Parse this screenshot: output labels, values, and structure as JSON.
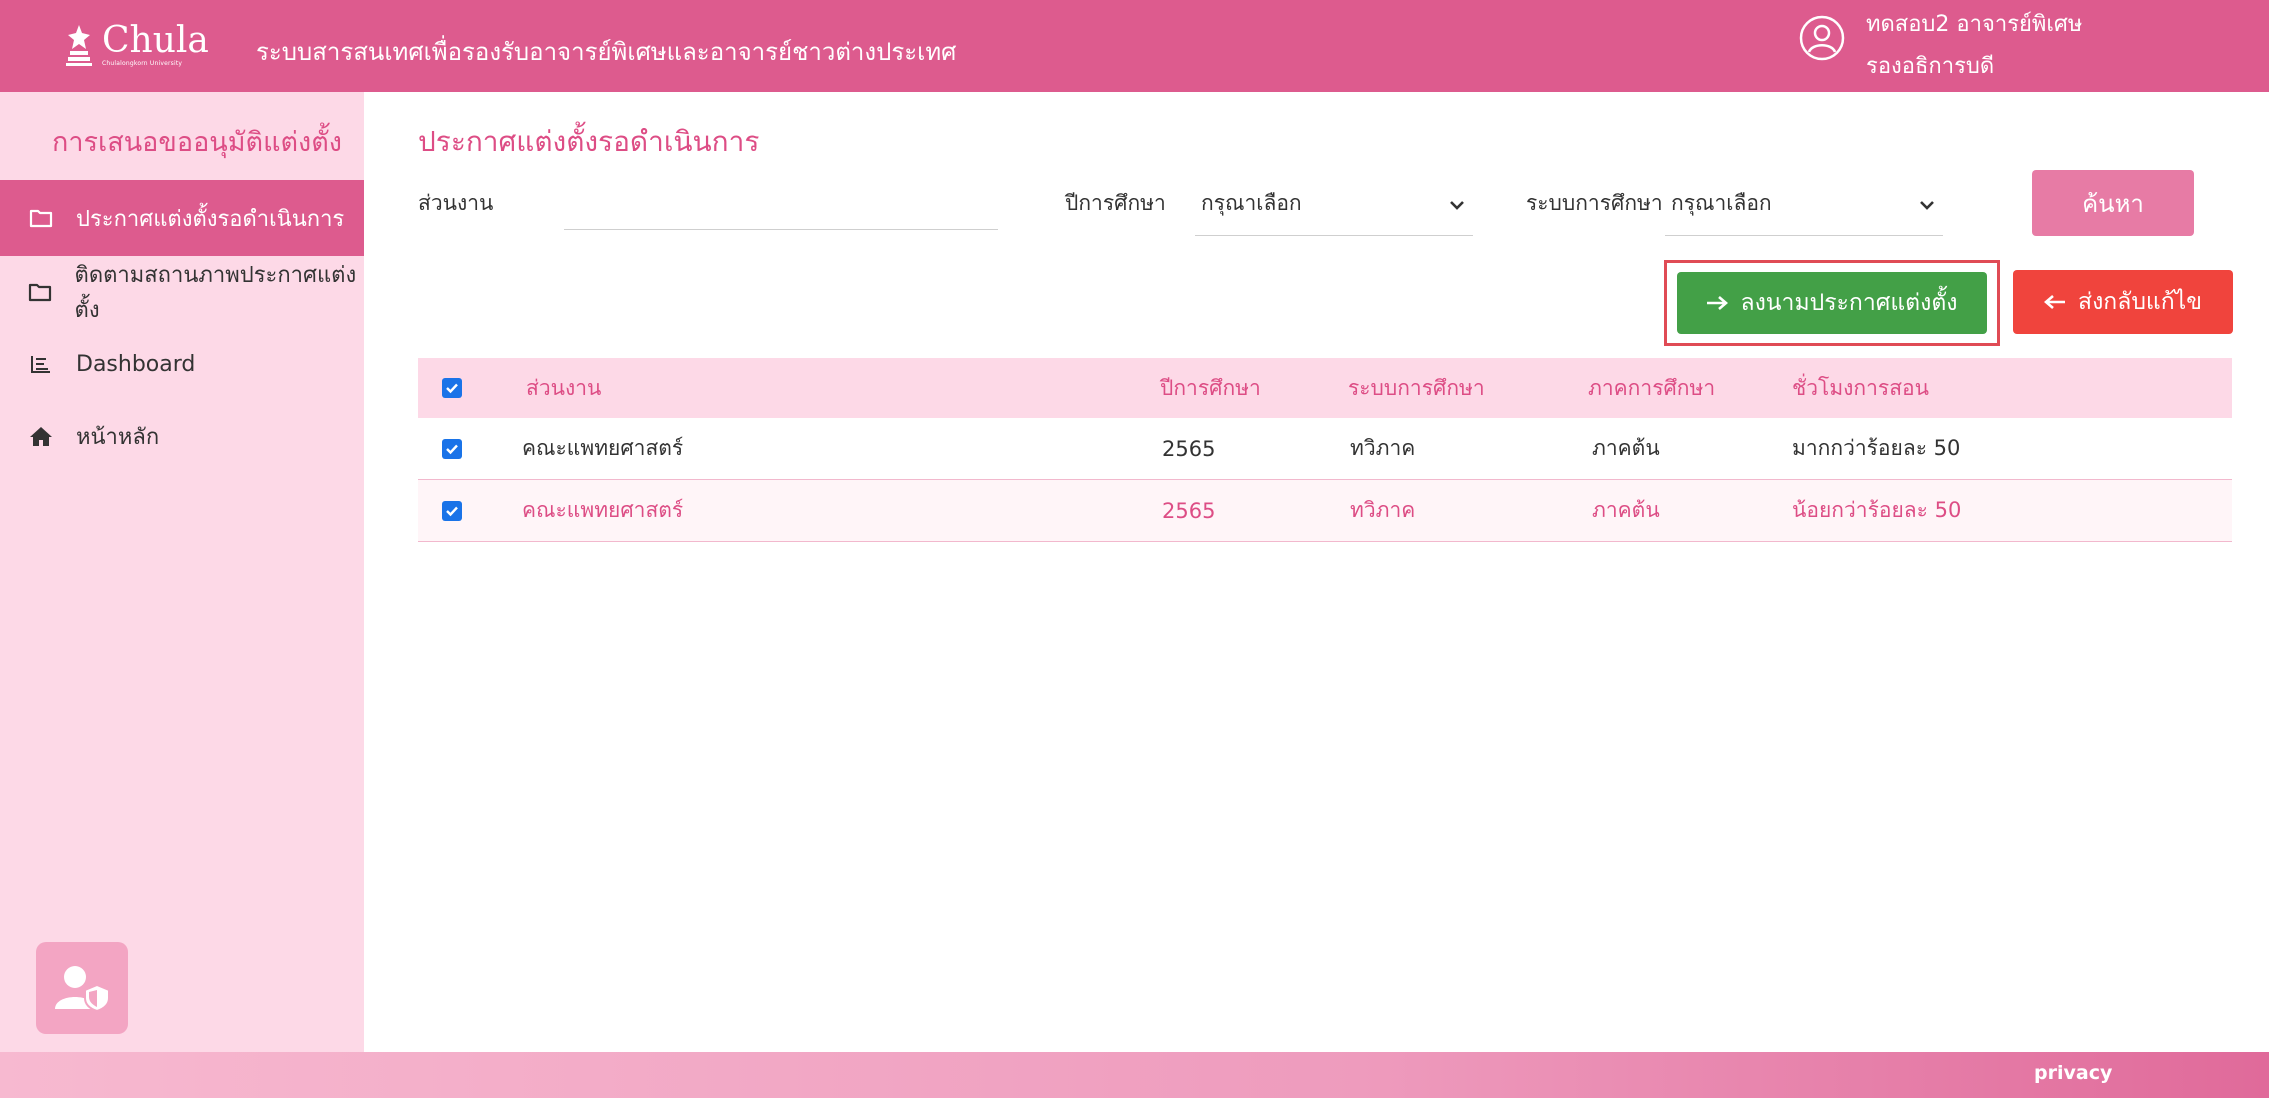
{
  "header": {
    "logo_word": "Chula",
    "logo_sub": "Chulalongkorn University",
    "title": "ระบบสารสนเทศเพื่อรองรับอาจารย์พิเศษและอาจารย์ชาวต่างประเทศ",
    "user_name": "ทดสอบ2 อาจารย์พิเศษ",
    "user_role": "รองอธิการบดี"
  },
  "sidebar": {
    "heading": "การเสนอขออนุมัติแต่งตั้ง",
    "items": [
      {
        "label": "ประกาศแต่งตั้งรอดำเนินการ",
        "icon": "folder-icon"
      },
      {
        "label": "ติดตามสถานภาพประกาศแต่งตั้ง",
        "icon": "folder-icon"
      },
      {
        "label": "Dashboard",
        "icon": "list-icon"
      },
      {
        "label": "หน้าหลัก",
        "icon": "home-icon"
      }
    ]
  },
  "main": {
    "page_title": "ประกาศแต่งตั้งรอดำเนินการ",
    "filters": {
      "unit_label": "ส่วนงาน",
      "unit_value": "",
      "year_label": "ปีการศึกษา",
      "year_value": "กรุณาเลือก",
      "system_label": "ระบบการศึกษา",
      "system_value": "กรุณาเลือก"
    },
    "buttons": {
      "search": "ค้นหา",
      "sign": "ลงนามประกาศแต่งตั้ง",
      "return": "ส่งกลับแก้ไข"
    }
  },
  "table": {
    "columns": [
      "ส่วนงาน",
      "ปีการศึกษา",
      "ระบบการศึกษา",
      "ภาคการศึกษา",
      "ชั่วโมงการสอน"
    ],
    "rows": [
      {
        "unit": "คณะแพทยศาสตร์",
        "year": "2565",
        "system": "ทวิภาค",
        "term": "ภาคต้น",
        "hours": "มากกว่าร้อยละ 50",
        "checked": true
      },
      {
        "unit": "คณะแพทยศาสตร์",
        "year": "2565",
        "system": "ทวิภาค",
        "term": "ภาคต้น",
        "hours": "น้อยกว่าร้อยละ 50",
        "checked": true
      }
    ]
  },
  "footer": {
    "privacy": "privacy"
  },
  "colors": {
    "primary": "#dd5b8e",
    "sidebar_bg": "#fdd9e7",
    "sign_button": "#43a047",
    "return_button": "#f0443d",
    "checkbox": "#1a73e8"
  }
}
